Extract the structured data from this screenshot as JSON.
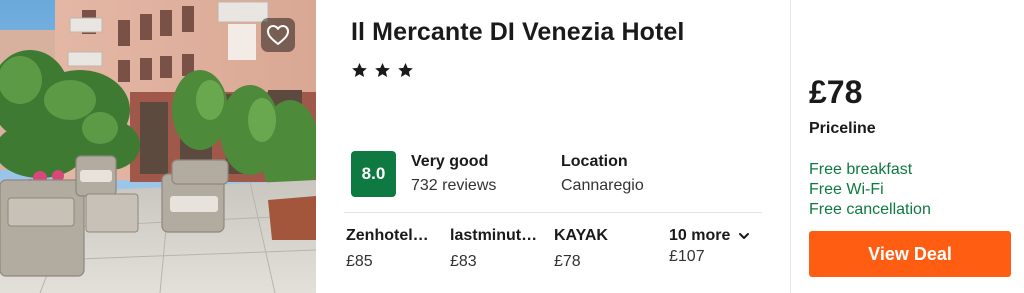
{
  "hotel": {
    "name": "Il Mercante DI Venezia Hotel",
    "star_count": 3,
    "favorite_icon": "heart-outline-icon"
  },
  "rating": {
    "score": "8.0",
    "label": "Very good",
    "reviews": "732 reviews",
    "badge_color": "#0e7a41"
  },
  "location": {
    "label": "Location",
    "value": "Cannaregio"
  },
  "providers": [
    {
      "name": "Zenhotel…",
      "price": "£85"
    },
    {
      "name": "lastminut…",
      "price": "£83"
    },
    {
      "name": "KAYAK",
      "price": "£78"
    }
  ],
  "more_providers": {
    "label": "10 more",
    "price": "£107",
    "icon": "chevron-down-icon"
  },
  "deal": {
    "price": "£78",
    "site": "Priceline",
    "amenities": [
      "Free breakfast",
      "Free Wi-Fi",
      "Free cancellation"
    ],
    "amenity_color": "#0e7a41",
    "button_label": "View Deal",
    "button_color": "#ff5d12"
  }
}
